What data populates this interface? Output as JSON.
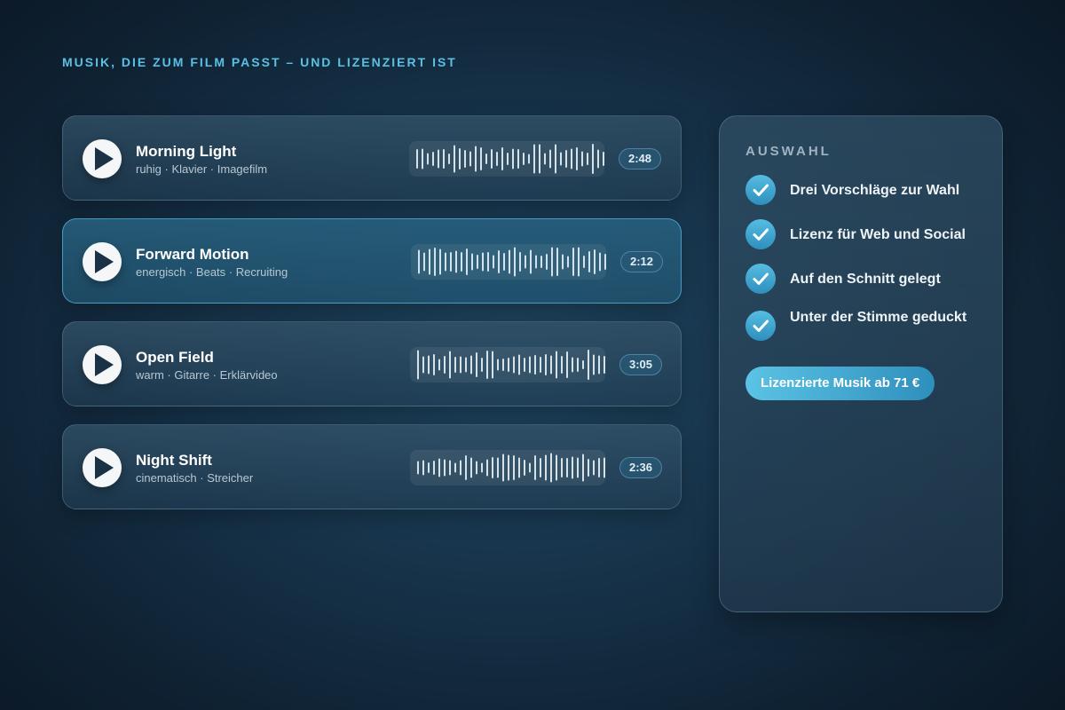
{
  "heading": "MUSIK, DIE ZUM FILM PASST – UND LIZENZIERT IST",
  "tracks": [
    {
      "title": "Morning Light",
      "tags": "ruhig · Klavier · Imagefilm",
      "duration": "2:48",
      "active": false
    },
    {
      "title": "Forward Motion",
      "tags": "energisch · Beats · Recruiting",
      "duration": "2:12",
      "active": true
    },
    {
      "title": "Open Field",
      "tags": "warm · Gitarre · Erklärvideo",
      "duration": "3:05",
      "active": false
    },
    {
      "title": "Night Shift",
      "tags": "cinematisch · Streicher",
      "duration": "2:36",
      "active": false
    }
  ],
  "sidebar": {
    "title": "AUSWAHL",
    "features": [
      {
        "label": "Drei Vorschläge zur Wahl"
      },
      {
        "label": "Lizenz für Web und Social"
      },
      {
        "label": "Auf den Schnitt gelegt"
      },
      {
        "label": "Unter der Stimme geduckt"
      }
    ],
    "cta_label": "Lizenzierte Musik ab 71 €"
  },
  "icons": {
    "play": "play-icon",
    "check": "check-icon",
    "waveform": "waveform-icon"
  },
  "colors": {
    "accent": "#5bc0e3",
    "active_border": "#5ab9e1",
    "cta_start": "#5bc3e5",
    "cta_end": "#2f8fbc"
  }
}
